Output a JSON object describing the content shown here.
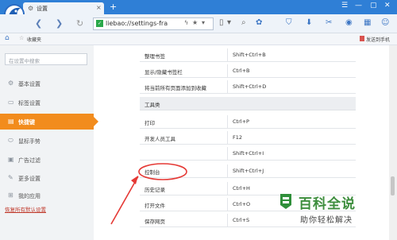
{
  "tab": {
    "title": "设置"
  },
  "url": {
    "text": "liebao://settings-fra"
  },
  "bookmarks": {
    "folder_label": "收藏夹",
    "send_to_phone": "发送到手机"
  },
  "sidebar": {
    "search_placeholder": "在设置中搜索",
    "items": [
      {
        "label": "基本设置",
        "icon": "gear-icon"
      },
      {
        "label": "标签设置",
        "icon": "tabs-icon"
      },
      {
        "label": "快捷键",
        "icon": "keyboard-icon",
        "active": true
      },
      {
        "label": "鼠标手势",
        "icon": "mouse-icon"
      },
      {
        "label": "广告过滤",
        "icon": "filter-icon"
      },
      {
        "label": "更多设置",
        "icon": "wrench-icon"
      },
      {
        "label": "我的应用",
        "icon": "apps-icon"
      }
    ],
    "restore_label": "恢复所有默认设置"
  },
  "shortcuts": {
    "rows_top": [
      {
        "action": "整理书签",
        "keys": "Shift+Ctrl+B"
      },
      {
        "action": "显示/隐藏书签栏",
        "keys": "Ctrl+B"
      },
      {
        "action": "将当前所有页面添加到收藏",
        "keys": "Shift+Ctrl+D"
      }
    ],
    "section_title": "工具类",
    "rows_tools": [
      {
        "action": "打印",
        "keys": "Ctrl+P"
      },
      {
        "action": "开发人员工具",
        "keys": "F12"
      },
      {
        "action": "",
        "keys": "Shift+Ctrl+I"
      },
      {
        "action": "控制台",
        "keys": "Shift+Ctrl+J"
      },
      {
        "action": "历史记录",
        "keys": "Ctrl+H"
      },
      {
        "action": "打开文件",
        "keys": "Ctrl+O"
      },
      {
        "action": "保存网页",
        "keys": "Ctrl+S"
      }
    ]
  },
  "watermark": {
    "big": "百科全说",
    "small": "助你轻松解决"
  },
  "colors": {
    "accent": "#f28c1d",
    "chrome": "#2f7fd6",
    "annotation": "#e53935"
  }
}
